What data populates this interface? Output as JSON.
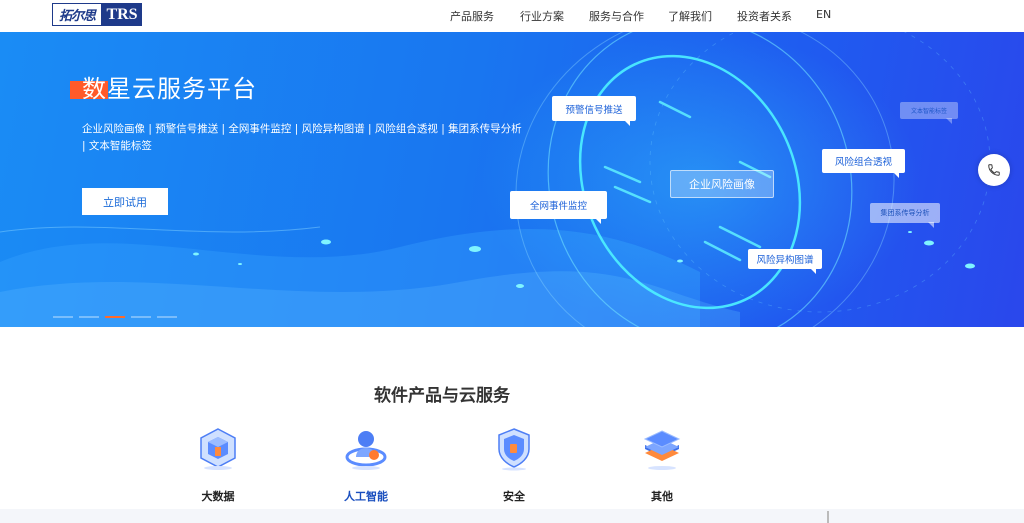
{
  "header": {
    "logo_cn": "拓尔思",
    "logo_en": "TRS",
    "nav": [
      "产品服务",
      "行业方案",
      "服务与合作",
      "了解我们",
      "投资者关系",
      "EN"
    ]
  },
  "banner": {
    "title": "数星云服务平台",
    "description": "企业风险画像 | 预警信号推送 | 全网事件监控 | 风险异构图谱 | 风险组合透视 | 集团系传导分析 | 文本智能标签",
    "cta": "立即试用",
    "tags": {
      "warning": "预警信号推送",
      "center": "企业风险画像",
      "event": "全网事件监控",
      "combo": "风险组合透视",
      "graph": "风险异构图谱",
      "text": "文本智能标签",
      "group": "集团系传导分析"
    },
    "slides_count": 5,
    "active_slide": 3,
    "colors": {
      "accent": "#ff5a2a",
      "banner_start": "#1a8cf5",
      "banner_end": "#2a47ec"
    }
  },
  "products": {
    "title": "软件产品与云服务",
    "items": [
      {
        "label": "大数据",
        "icon": "cube-data-icon"
      },
      {
        "label": "人工智能",
        "icon": "ai-figure-icon"
      },
      {
        "label": "安全",
        "icon": "shield-icon"
      },
      {
        "label": "其他",
        "icon": "layers-icon"
      }
    ]
  }
}
